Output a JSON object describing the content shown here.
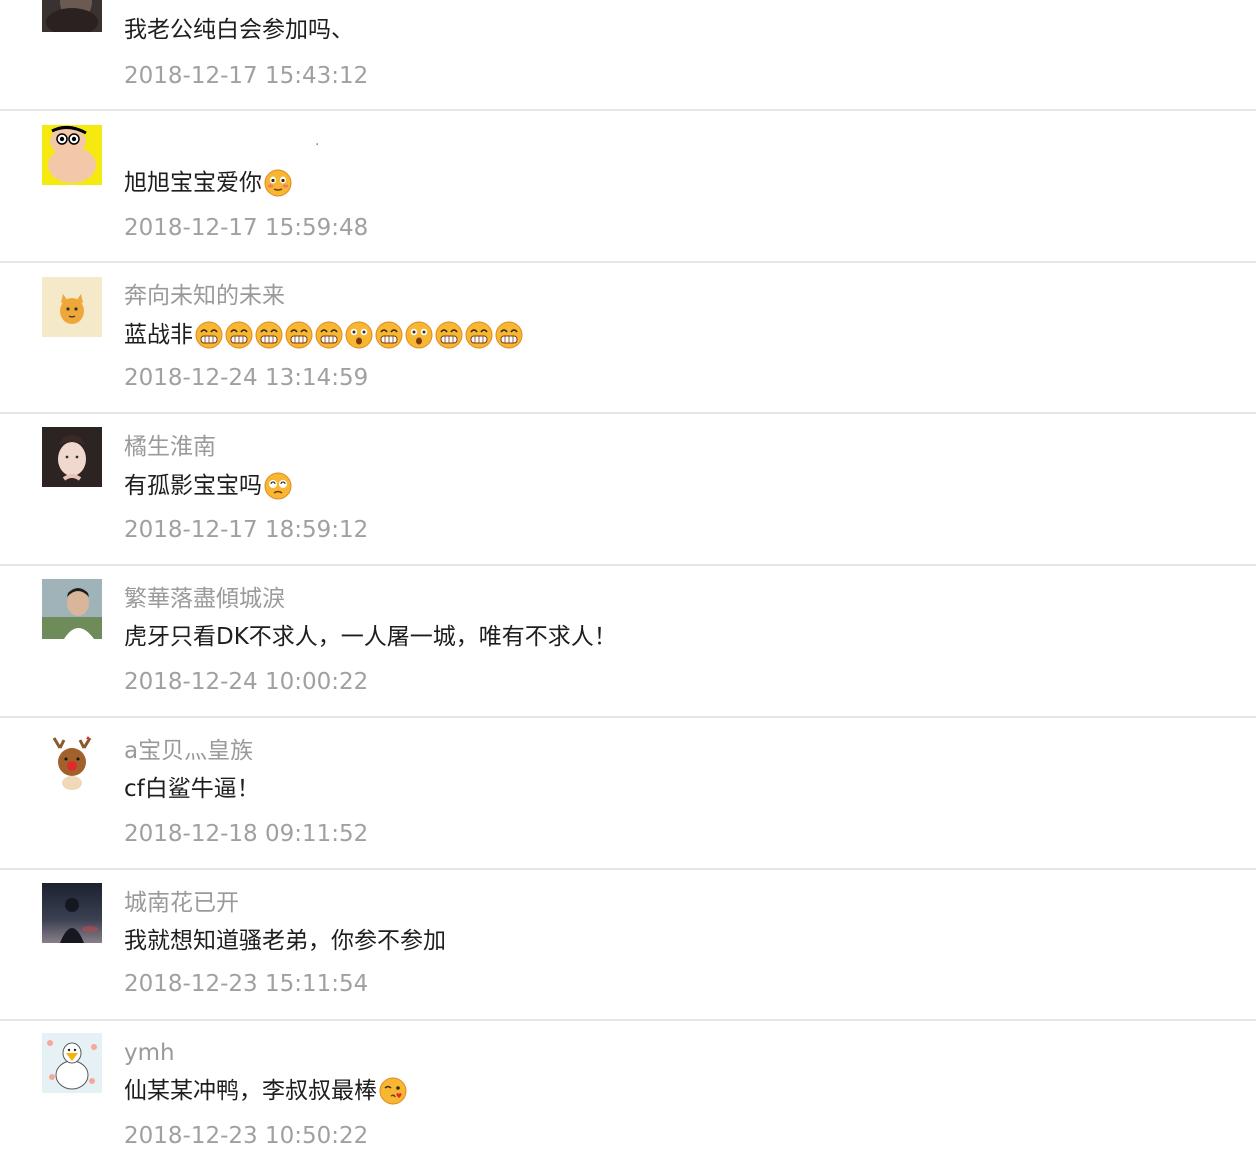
{
  "comments": [
    {
      "name": "",
      "text": "我老公纯白会参加吗、",
      "time": "2018-12-17 15:43:12",
      "avatar": "dark-portrait-avatar"
    },
    {
      "name": "",
      "text": "旭旭宝宝爱你",
      "time": "2018-12-17 15:59:48",
      "avatar": "crayon-shin-chan-avatar",
      "emojis": [
        "blush-emoji"
      ]
    },
    {
      "name": "奔向未知的未来",
      "text": "蓝战非",
      "time": "2018-12-24 13:14:59",
      "avatar": "cartoon-dog-avatar",
      "emojis": [
        "grin-emoji",
        "grin-emoji",
        "grin-emoji",
        "grin-emoji",
        "grin-emoji",
        "surprised-emoji",
        "grin-emoji",
        "surprised-emoji",
        "grin-emoji",
        "grin-emoji",
        "grin-emoji"
      ]
    },
    {
      "name": "橘生淮南",
      "text": "有孤影宝宝吗",
      "time": "2018-12-17 18:59:12",
      "avatar": "girl-portrait-avatar",
      "emojis": [
        "dizzy-emoji"
      ]
    },
    {
      "name": "繁華落盡傾城淚",
      "text": "虎牙只看DK不求人，一人屠一城，唯有不求人！",
      "time": "2018-12-24 10:00:22",
      "avatar": "man-portrait-avatar"
    },
    {
      "name": "a宝贝灬皇族",
      "text": "cf白鲨牛逼！",
      "time": "2018-12-18 09:11:52",
      "avatar": "reindeer-cartoon-avatar"
    },
    {
      "name": "城南花已开",
      "text": "我就想知道骚老弟，你参不参加",
      "time": "2018-12-23 15:11:54",
      "avatar": "night-silhouette-avatar"
    },
    {
      "name": "ymh",
      "text": "仙某某冲鸭，李叔叔最棒",
      "time": "2018-12-23 10:50:22",
      "avatar": "white-duck-avatar",
      "emojis": [
        "kiss-emoji"
      ]
    }
  ]
}
